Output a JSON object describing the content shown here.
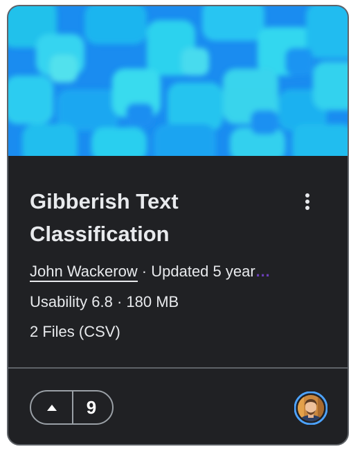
{
  "card": {
    "title": "Gibberish Text Classification",
    "author": "John Wackerow",
    "updated": " · Updated 5 year",
    "usability": "Usability 6.8 · 180 MB",
    "files": "2 Files (CSV)",
    "upvotes": "9"
  },
  "colors": {
    "card_bg": "#202124",
    "border": "#5f6368",
    "text": "#e8eaed",
    "thumbnail_primary": "#1a8cf0",
    "thumbnail_secondary": "#22d3e6",
    "avatar_ring": "#4da3ff"
  },
  "icons": {
    "menu": "more-vertical-icon",
    "upvote": "triangle-up-icon",
    "avatar": "user-avatar"
  }
}
